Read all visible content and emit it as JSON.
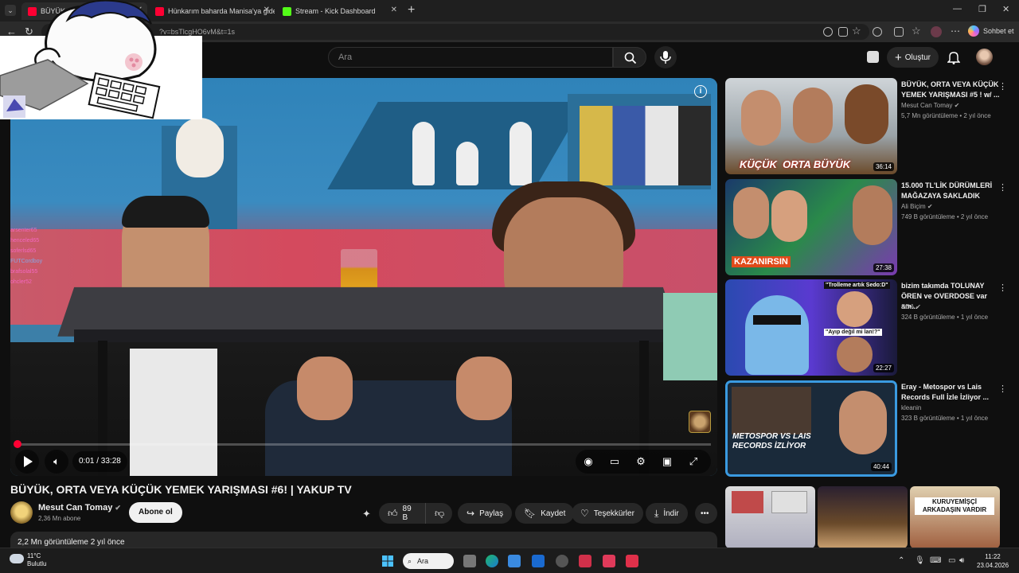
{
  "browser": {
    "tabs": [
      {
        "label": "BÜYÜK, ORTA",
        "active": true
      },
      {
        "label": "Hünkarım baharda Manisa'ya gide",
        "active": false
      },
      {
        "label": "Stream - Kick Dashboard",
        "active": false
      }
    ],
    "url": "?v=bsTlcgHO6vM&t=1s",
    "copilot_label": "Sohbet et"
  },
  "youtube": {
    "search_placeholder": "Ara",
    "create_label": "Oluştur"
  },
  "player": {
    "time": "0:01 / 33:28",
    "progress_fraction": 0.0005,
    "chat_lines": [
      "arsenter65",
      "henceled65",
      "soferlsd65",
      "FUTCordboy",
      "brafsolal55",
      "ohcler52"
    ]
  },
  "video": {
    "title": "BÜYÜK, ORTA VEYA KÜÇÜK YEMEK YARIŞMASI #6! | YAKUP TV",
    "channel": "Mesut Can Tomay",
    "subscribers": "2,36 Mn abone",
    "subscribe_label": "Abone ol",
    "likes": "89 B",
    "share_label": "Paylaş",
    "save_label": "Kaydet",
    "thanks_label": "Teşekkürler",
    "download_label": "İndir",
    "description_meta": "2,2 Mn görüntüleme  2 yıl önce"
  },
  "recommendations": [
    {
      "title": "BÜYÜK, ORTA VEYA KÜÇÜK YEMEK YARIŞMASI #5 ! w/ ...",
      "channel": "Mesut Can Tomay",
      "meta": "5,7 Mn görüntüleme • 2 yıl önce",
      "duration": "36:14",
      "thumb_text": "KÜÇÜK  ORTA BÜYÜK"
    },
    {
      "title": "15.000 TL'LİK DÜRÜMLERİ MAĞAZAYA SAKLADIK",
      "channel": "Ali Biçim",
      "meta": "749 B görüntüleme • 2 yıl önce",
      "duration": "27:38",
      "thumb_text": "KAZANIRSIN"
    },
    {
      "title": "bizim takımda TOLUNAY ÖREN ve OVERDOSE var am...",
      "channel": "SDA",
      "meta": "324 B görüntüleme • 1 yıl önce",
      "duration": "22:27",
      "thumb_text_1": "\"Trolleme artık Sedo:D\"",
      "thumb_text_2": "\"Ayıp değil mi lan!?\""
    },
    {
      "title": "Eray - Metospor vs Lais Records Full İzle İzliyor ...",
      "channel": "kleanin",
      "meta": "323 B görüntüleme • 1 yıl önce",
      "duration": "40:44",
      "thumb_text": "METOSPOR VS LAIS RECORDS İZLİYOR"
    }
  ],
  "shorts": [
    {
      "text": ""
    },
    {
      "text": ""
    },
    {
      "text": "KURUYEMİŞÇİ ARKADAŞIN VARDIR"
    }
  ],
  "taskbar": {
    "weather_temp": "11°C",
    "weather_desc": "Bulutlu",
    "search_label": "Ara",
    "time": "11:22",
    "date": "23.04.2026"
  },
  "colors": {
    "accent": "#ff0033",
    "background": "#0f0f0f"
  }
}
